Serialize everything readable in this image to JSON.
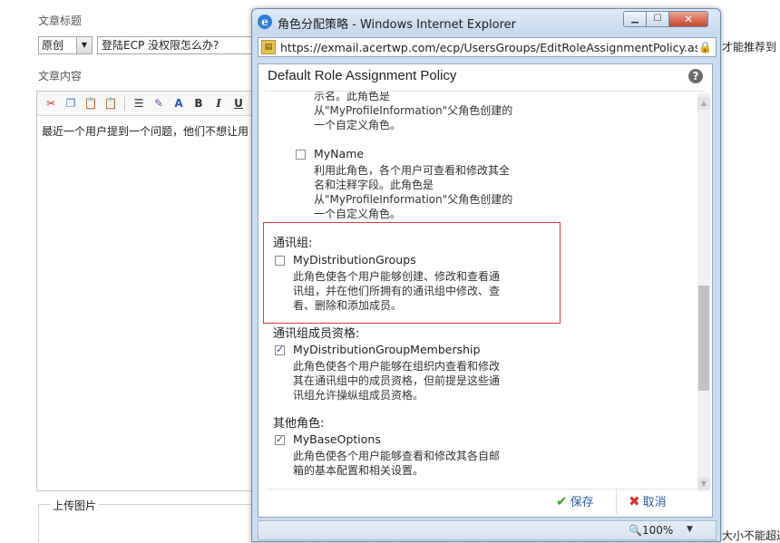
{
  "background": {
    "title_label": "文章标题",
    "category_value": "原创",
    "title_value": "登陆ECP 没权限怎么办?",
    "right_text": "才能推荐到",
    "content_label": "文章内容",
    "content_text": "最近一个用户提到一个问题，他们不想让用",
    "upload_label": "上传图片",
    "bottom_right_text": "大小不能超过",
    "toolbar_labels": {
      "bold": "B",
      "italic": "I",
      "underline": "U"
    }
  },
  "ie": {
    "window_title": "角色分配策略 - Windows Internet Explorer",
    "url": "https://exmail.acertwp.com/ecp/UsersGroups/EditRoleAssignmentPolicy.aspx?p",
    "zoom": "100%"
  },
  "dialog": {
    "header": "Default Role Assignment Policy",
    "help": "?",
    "partial_desc_lines": [
      "示名。此角色是",
      "从\"MyProfileInformation\"父角色创建的",
      "一个自定义角色。"
    ],
    "myname": {
      "name": "MyName",
      "checked": false,
      "desc_lines": [
        "利用此角色，各个用户可查看和修改其全",
        "名和注释字段。此角色是",
        "从\"MyProfileInformation\"父角色创建的",
        "一个自定义角色。"
      ]
    },
    "sections": [
      {
        "title": "通讯组:",
        "role": "MyDistributionGroups",
        "checked": false,
        "desc_lines": [
          "此角色使各个用户能够创建、修改和查看通",
          "讯组，并在他们所拥有的通讯组中修改、查",
          "看、删除和添加成员。"
        ]
      },
      {
        "title": "通讯组成员资格:",
        "role": "MyDistributionGroupMembership",
        "checked": true,
        "desc_lines": [
          "此角色使各个用户能够在组织内查看和修改",
          "其在通讯组中的成员资格，但前提是这些通",
          "讯组允许操纵组成员资格。"
        ]
      },
      {
        "title": "其他角色:",
        "role": "MyBaseOptions",
        "checked": true,
        "desc_lines": [
          "此角色使各个用户能够查看和修改其各自邮",
          "箱的基本配置和相关设置。"
        ]
      }
    ],
    "save_label": "保存",
    "cancel_label": "取消"
  }
}
